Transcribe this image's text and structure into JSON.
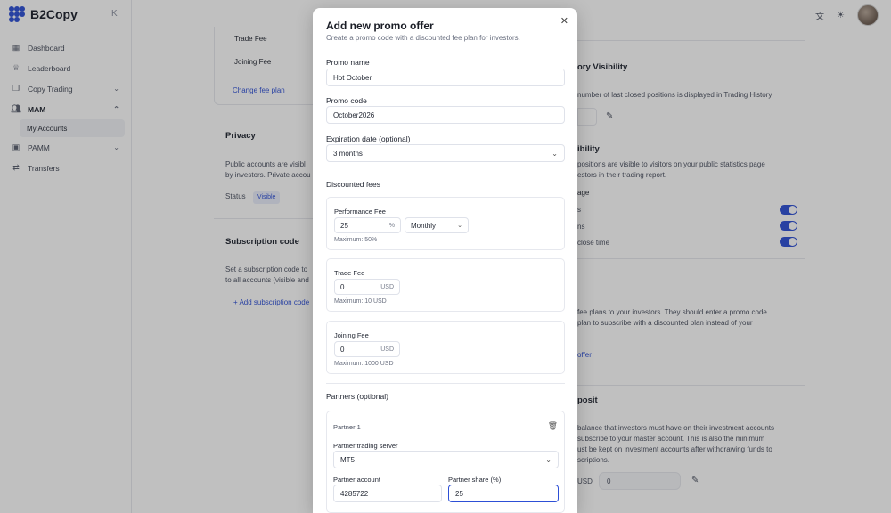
{
  "app": {
    "name": "B2Copy"
  },
  "sidebar": {
    "items": [
      {
        "label": "Dashboard"
      },
      {
        "label": "Leaderboard"
      },
      {
        "label": "Copy Trading"
      },
      {
        "label": "MAM"
      },
      {
        "label": "My Accounts"
      },
      {
        "label": "PAMM"
      },
      {
        "label": "Transfers"
      }
    ]
  },
  "background": {
    "trade_fee": "Trade Fee",
    "joining_fee": "Joining Fee",
    "change_fee_plan": "Change fee plan",
    "privacy_title": "Privacy",
    "privacy_text_1": "Public accounts are visibl",
    "privacy_text_2": "by investors. Private accou",
    "status_label": "Status",
    "status_value": "Visible",
    "subscription_title": "Subscription code",
    "subscription_text_1": "Set a subscription code to",
    "subscription_text_2": "to all accounts (visible and",
    "add_subscription": "+ Add subscription code",
    "history_title": "ory Visibility",
    "history_text": "number of last closed positions is displayed in Trading History",
    "visibility_title": "ibility",
    "visibility_text_1": "positions are visible to visitors on your public statistics page",
    "visibility_text_2": "estors in their trading report.",
    "visibility_page": "age",
    "toggle_row_1": "s",
    "toggle_row_2": "ns",
    "toggle_row_3": "close time",
    "promo_text_1": "fee plans to your investors. They should enter a promo code",
    "promo_text_2": "plan to subscribe with a discounted plan instead of your",
    "promo_link": "offer",
    "deposit_title": "posit",
    "deposit_text_1": "balance that investors must have on their investment accounts",
    "deposit_text_2": "subscribe to your master account. This is also the minimum",
    "deposit_text_3": "ust be kept on investment accounts after withdrawing funds to",
    "deposit_text_4": "scriptions.",
    "deposit_currency": "USD",
    "deposit_value": "0"
  },
  "modal": {
    "title": "Add new promo offer",
    "subtitle": "Create a promo code with a discounted fee plan for investors.",
    "promo_name_label": "Promo name",
    "promo_name_value": "Hot October",
    "promo_code_label": "Promo code",
    "promo_code_value": "October2026",
    "expiration_label": "Expiration date (optional)",
    "expiration_value": "3 months",
    "discounted_fees_label": "Discounted fees",
    "performance_fee": {
      "title": "Performance Fee",
      "value": "25",
      "unit": "%",
      "period": "Monthly",
      "hint": "Maximum: 50%"
    },
    "trade_fee": {
      "title": "Trade Fee",
      "value": "0",
      "unit": "USD",
      "hint": "Maximum: 10 USD"
    },
    "joining_fee": {
      "title": "Joining Fee",
      "value": "0",
      "unit": "USD",
      "hint": "Maximum: 1000 USD"
    },
    "partners_label": "Partners (optional)",
    "partner": {
      "title": "Partner 1",
      "server_label": "Partner trading server",
      "server_value": "MT5",
      "account_label": "Partner account",
      "account_value": "4285722",
      "share_label": "Partner share (%)",
      "share_value": "25"
    }
  }
}
